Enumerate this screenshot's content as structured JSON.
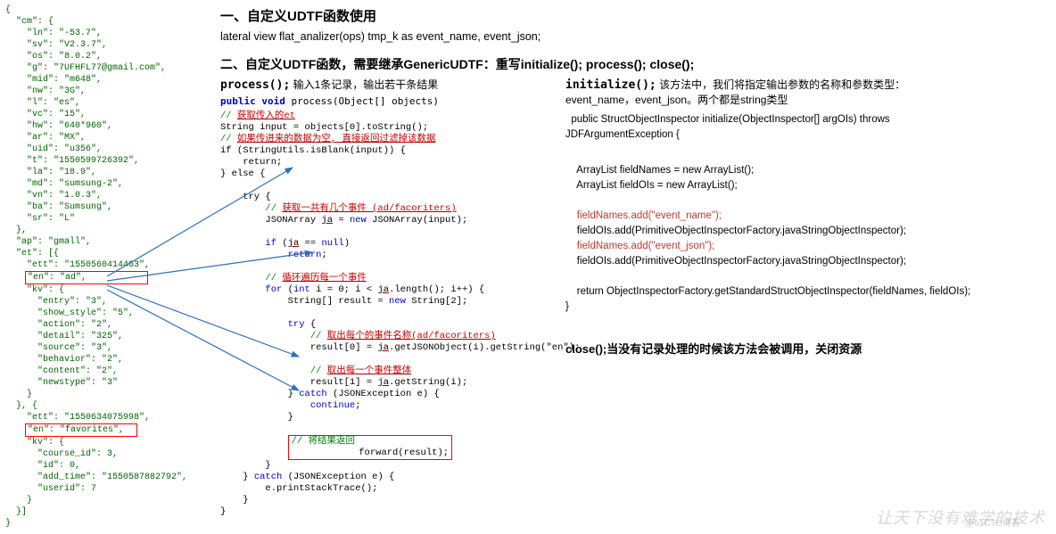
{
  "left_json": {
    "lines": [
      "{",
      "  \"cm\": {",
      "    \"ln\": \"-53.7\",",
      "    \"sv\": \"V2.3.7\",",
      "    \"os\": \"8.0.2\",",
      "    \"g\": \"7UFHFL77@gmail.com\",",
      "    \"mid\": \"m648\",",
      "    \"nw\": \"3G\",",
      "    \"l\": \"es\",",
      "    \"vc\": \"15\",",
      "    \"hw\": \"640*960\",",
      "    \"ar\": \"MX\",",
      "    \"uid\": \"u356\",",
      "    \"t\": \"1550599726392\",",
      "    \"la\": \"18.9\",",
      "    \"md\": \"sumsung-2\",",
      "    \"vn\": \"1.0.3\",",
      "    \"ba\": \"Sumsung\",",
      "    \"sr\": \"L\"",
      "  },",
      "  \"ap\": \"gmall\",",
      "  \"et\": [{",
      "    \"ett\": \"1550560414463\",",
      "    \"en\": \"ad\",           ",
      "    \"kv\": {",
      "      \"entry\": \"3\",",
      "      \"show_style\": \"5\",",
      "      \"action\": \"2\",",
      "      \"detail\": \"325\",",
      "      \"source\": \"3\",",
      "      \"behavior\": \"2\",",
      "      \"content\": \"2\",",
      "      \"newstype\": \"3\"",
      "    }",
      "  }, {",
      "    \"ett\": \"1550634075998\",",
      "    \"en\": \"favorites\",  ",
      "    \"kv\": {",
      "      \"course_id\": 3,",
      "      \"id\": 0,",
      "      \"add_time\": \"1550587882792\",",
      "      \"userid\": 7",
      "    }",
      "  }]",
      "}"
    ],
    "redbox_indices": [
      23,
      36
    ]
  },
  "titles": {
    "section1": "一、自定义UDTF函数使用",
    "sql": "lateral view flat_analizer(ops) tmp_k as event_name, event_json;",
    "section2": "二、自定义UDTF函数，需要继承GenericUDTF：重写initialize();  process(); close();",
    "process_head": "process();",
    "process_desc": " 输入1条记录，输出若干条结果",
    "process_sig_prefix": "public void",
    "process_sig_rest": " process(Object[] objects)",
    "init_head": "initialize();",
    "init_desc_1": " 该方法中，我们将指定输出参数的名称和参数类型：",
    "init_desc_2": "event_name，event_json。两个都是string类型",
    "init_sig_1": "  public StructObjectInspector initialize(ObjectInspector[] argOIs) throws",
    "init_sig_2": "JDFArgumentException {",
    "close_head": "close();",
    "close_desc": "当没有记录处理的时候该方法会被调用，关闭资源"
  },
  "process_code": {
    "c1": "// 获取传入的et",
    "l1": "String input = objects[0].toString();",
    "c2": "// 如果传进来的数据为空, 直接返回过滤掉该数据",
    "l2": "if (StringUtils.isBlank(input)) {",
    "l3": "    return;",
    "l4": "} else {",
    "l5": "    try {",
    "c3": "        // 获取一共有几个事件 (ad/facoriters)",
    "l6": "        JSONArray ja = new JSONArray(input);",
    "l7": "        if (ja == null)",
    "l8": "            return;",
    "c4": "        // 循环遍历每一个事件",
    "l9": "        for (int i = 0; i < ja.length(); i++) {",
    "l10": "            String[] result = new String[2];",
    "l11": "            try {",
    "c5": "                // 取出每个的事件名称(ad/facoriters)",
    "l12": "                result[0] = ja.getJSONObject(i).getString(\"en\");",
    "c6": "                // 取出每一个事件整体",
    "l13": "                result[1] = ja.getString(i);",
    "l14": "            } catch (JSONException e) {",
    "l15": "                continue;",
    "l16": "            }",
    "c7": "            // 将结果返回",
    "l17": "            forward(result);",
    "l18": "        }",
    "l19": "    } catch (JSONException e) {",
    "l20": "        e.printStackTrace();",
    "l21": "    }",
    "l22": "}"
  },
  "init_code": {
    "l1": "    ArrayList<String> fieldNames = new ArrayList<String>();",
    "l2": "    ArrayList<ObjectInspector> fieldOIs = new ArrayList<ObjectInspector>();",
    "r1": "    fieldNames.add(\"event_name\");",
    "l3": "    fieldOIs.add(PrimitiveObjectInspectorFactory.javaStringObjectInspector);",
    "r2": "    fieldNames.add(\"event_json\");",
    "l4": "    fieldOIs.add(PrimitiveObjectInspectorFactory.javaStringObjectInspector);",
    "l5": "    return ObjectInspectorFactory.getStandardStructObjectInspector(fieldNames, fieldOIs);",
    "l6": "}"
  },
  "watermark": "让天下没有难学的技术",
  "watermark2": "@51CTO博客"
}
